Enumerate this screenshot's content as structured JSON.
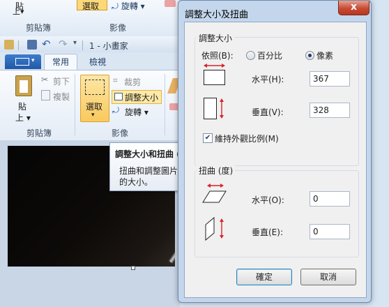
{
  "paint": {
    "clipboard_group_label_top": "剪貼簿",
    "image_group_label_top": "影像",
    "paste_fragment_top": "貼",
    "paste_menu_fragment_top": "上",
    "select_label_top": "選取",
    "rotate_label_top": "旋轉",
    "document_title": "1 - 小畫家",
    "tabs": {
      "home": "常用",
      "view": "檢視"
    },
    "clipboard": {
      "paste_label": "貼",
      "paste_menu": "上",
      "cut_label": "剪下",
      "copy_label": "複製",
      "group_label": "剪貼簿"
    },
    "image": {
      "select_label": "選取",
      "crop_label": "裁剪",
      "resize_label": "調整大小",
      "rotate_label": "旋轉",
      "group_label": "影像"
    },
    "tooltip": {
      "title": "調整大小和扭曲 (",
      "body_line1": "扭曲和調整圖片",
      "body_line2": "的大小。"
    }
  },
  "dialog": {
    "title": "調整大小及扭曲",
    "close_glyph": "x",
    "resize": {
      "group_label": "調整大小",
      "by_label": "依照(B):",
      "percent_label": "百分比",
      "pixels_label": "像素",
      "selected_unit": "像素",
      "horizontal_label": "水平(H):",
      "horizontal_value": "367",
      "vertical_label": "垂直(V):",
      "vertical_value": "328",
      "maintain_label": "維持外觀比例(M)",
      "maintain_checked": true
    },
    "skew": {
      "group_label": "扭曲 (度)",
      "horizontal_label": "水平(O):",
      "horizontal_value": "0",
      "vertical_label": "垂直(E):",
      "vertical_value": "0"
    },
    "ok_label": "確定",
    "cancel_label": "取消"
  },
  "colors": {
    "accent_red_arrow": "#d8232a",
    "file_tab_blue": "#2a63b4",
    "dialog_frame": "#c4d6ec",
    "selection_highlight": "#fbd878"
  }
}
